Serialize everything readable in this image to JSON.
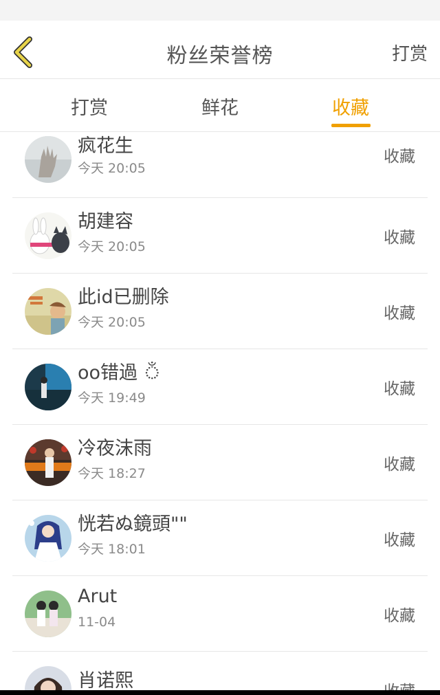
{
  "header": {
    "back_icon": "chevron-left-icon",
    "title": "粉丝荣誉榜",
    "action_label": "打赏",
    "accent_color": "#f0a000",
    "back_icon_color": "#e8d44a"
  },
  "tabs": [
    {
      "label": "打赏",
      "active": false
    },
    {
      "label": "鲜花",
      "active": false
    },
    {
      "label": "收藏",
      "active": true
    }
  ],
  "list": [
    {
      "name": "疯花生",
      "time": "今天 20:05",
      "action": "收藏"
    },
    {
      "name": "胡建容",
      "time": "今天 20:05",
      "action": "收藏"
    },
    {
      "name": "此id已删除",
      "time": "今天 20:05",
      "action": "收藏"
    },
    {
      "name": "oo错過 ঁ",
      "time": "今天 19:49",
      "action": "收藏"
    },
    {
      "name": "冷夜沫雨",
      "time": "今天 18:27",
      "action": "收藏"
    },
    {
      "name": "恍若ぬ鏡頭\"\"",
      "time": "今天 18:01",
      "action": "收藏"
    },
    {
      "name": "Arut",
      "time": "11-04",
      "action": "收藏"
    },
    {
      "name": "肖诺熙",
      "time": "",
      "action": "收藏"
    }
  ]
}
